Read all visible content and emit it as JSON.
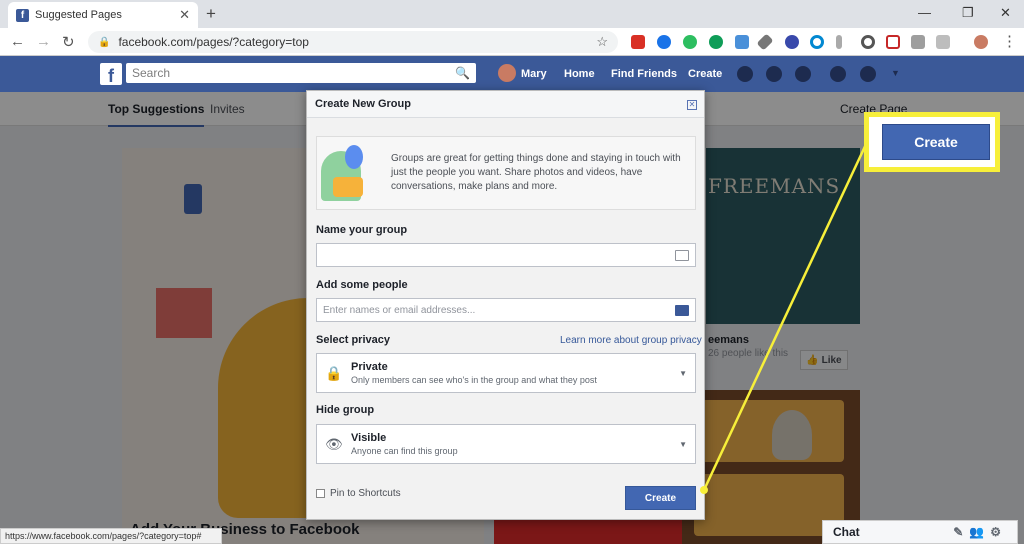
{
  "browser": {
    "tab_title": "Suggested Pages",
    "tab_close": "✕",
    "new_tab": "+",
    "url": "facebook.com/pages/?category=top",
    "status_url": "https://www.facebook.com/pages/?category=top#"
  },
  "fb_header": {
    "search_placeholder": "Search",
    "user_name": "Mary",
    "nav": [
      "Home",
      "Find Friends",
      "Create"
    ]
  },
  "subnav": {
    "tabs": [
      "Top Suggestions",
      "Invites"
    ],
    "create_page": "Create Page"
  },
  "background": {
    "business_title": "Add Your Business to Facebook",
    "freemans_sign": "FREEMANS",
    "freemans_name": "eemans",
    "freemans_likes": "26 people like this",
    "like_label": "Like"
  },
  "modal": {
    "title": "Create New Group",
    "intro": "Groups are great for getting things done and staying in touch with just the people you want. Share photos and videos, have conversations, make plans and more.",
    "name_label": "Name your group",
    "name_value": "",
    "people_label": "Add some people",
    "people_placeholder": "Enter names or email addresses...",
    "privacy_label": "Select privacy",
    "privacy_link": "Learn more about group privacy",
    "privacy_title": "Private",
    "privacy_desc": "Only members can see who's in the group and what they post",
    "hide_label": "Hide group",
    "hide_title": "Visible",
    "hide_desc": "Anyone can find this group",
    "pin_label": "Pin to Shortcuts",
    "create_label": "Create"
  },
  "callout": {
    "create_label": "Create",
    "color": "#f7ef3a"
  },
  "chat": {
    "label": "Chat"
  },
  "colors": {
    "fb_blue": "#3b5998",
    "button_blue": "#4267b2",
    "highlight": "#f7ef3a"
  }
}
